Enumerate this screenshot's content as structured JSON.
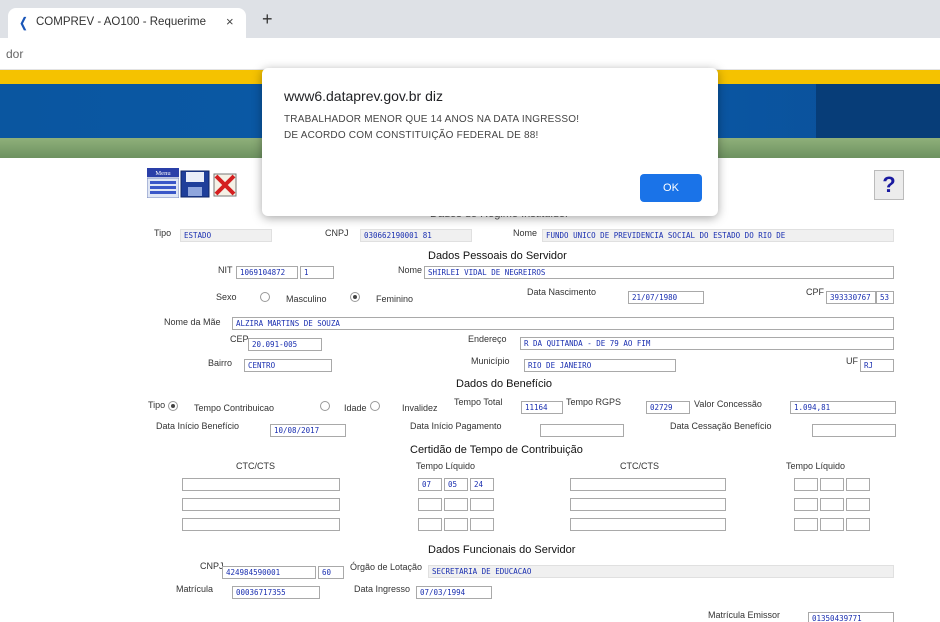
{
  "browser": {
    "tab_title": "COMPREV - AO100 - Requerime",
    "tab_close": "×",
    "new_tab": "+",
    "url_fragment": "dor"
  },
  "dialog": {
    "title": "www6.dataprev.gov.br diz",
    "message_line1": "TRABALHADOR MENOR QUE 14 ANOS NA DATA INGRESSO!",
    "message_line2": "DE ACORDO COM CONSTITUIÇÃO FEDERAL DE 88!",
    "ok_label": "OK"
  },
  "toolbar": {
    "menu_label": "Menu",
    "help_label": "?"
  },
  "regime": {
    "heading": "Dados do Regime Instituidor",
    "tipo_label": "Tipo",
    "tipo": "ESTADO",
    "cnpj_label": "CNPJ",
    "cnpj": "030662190001  81",
    "nome_label": "Nome",
    "nome": "FUNDO UNICO DE PREVIDENCIA SOCIAL DO ESTADO DO RIO DE"
  },
  "servidor": {
    "heading": "Dados Pessoais do Servidor",
    "nit_label": "NIT",
    "nit": "1069104872",
    "nit_dv": "1",
    "nome_label": "Nome",
    "nome": "SHIRLEI VIDAL DE NEGREIROS",
    "sexo_label": "Sexo",
    "masc_label": "Masculino",
    "fem_label": "Feminino",
    "nasc_label": "Data Nascimento",
    "nasc": "21/07/1980",
    "cpf_label": "CPF",
    "cpf": "393330767",
    "cpf_dv": "53",
    "mae_label": "Nome da Mãe",
    "mae": "ALZIRA MARTINS DE SOUZA",
    "cep_label": "CEP",
    "cep": "20.091-005",
    "endereco_label": "Endereço",
    "endereco": "R DA QUITANDA - DE 79 AO FIM",
    "bairro_label": "Bairro",
    "bairro": "CENTRO",
    "municipio_label": "Município",
    "municipio": "RIO DE JANEIRO",
    "uf_label": "UF",
    "uf": "RJ"
  },
  "beneficio": {
    "heading": "Dados do Benefício",
    "tipo_label": "Tipo",
    "tempo_contrib_label": "Tempo Contribuicao",
    "idade_label": "Idade",
    "invalidez_label": "Invalidez",
    "tempo_total_label": "Tempo Total",
    "tempo_total": "11164",
    "tempo_rgps_label": "Tempo RGPS",
    "tempo_rgps": "02729",
    "valor_label": "Valor Concessão",
    "valor": "1.094,81",
    "inicio_label": "Data Início Benefício",
    "inicio": "10/08/2017",
    "pagamento_label": "Data Início Pagamento",
    "cessacao_label": "Data Cessação Benefício"
  },
  "certidao": {
    "heading": "Certidão de Tempo de Contribuição",
    "ctc_label": "CTC/CTS",
    "liquido_label": "Tempo Líquido",
    "anos": "07",
    "meses": "05",
    "dias": "24"
  },
  "funcionais": {
    "heading": "Dados Funcionais do Servidor",
    "cnpj_label": "CNPJ",
    "cnpj": "424984590001",
    "cnpj_dv": "60",
    "orgao_label": "Órgão de Lotação",
    "orgao": "SECRETARIA DE EDUCACAO",
    "matricula_label": "Matrícula",
    "matricula": "00036717355",
    "ingresso_label": "Data Ingresso",
    "ingresso": "07/03/1994",
    "emissor_label": "Matrícula Emissor",
    "emissor": "01350439771"
  }
}
